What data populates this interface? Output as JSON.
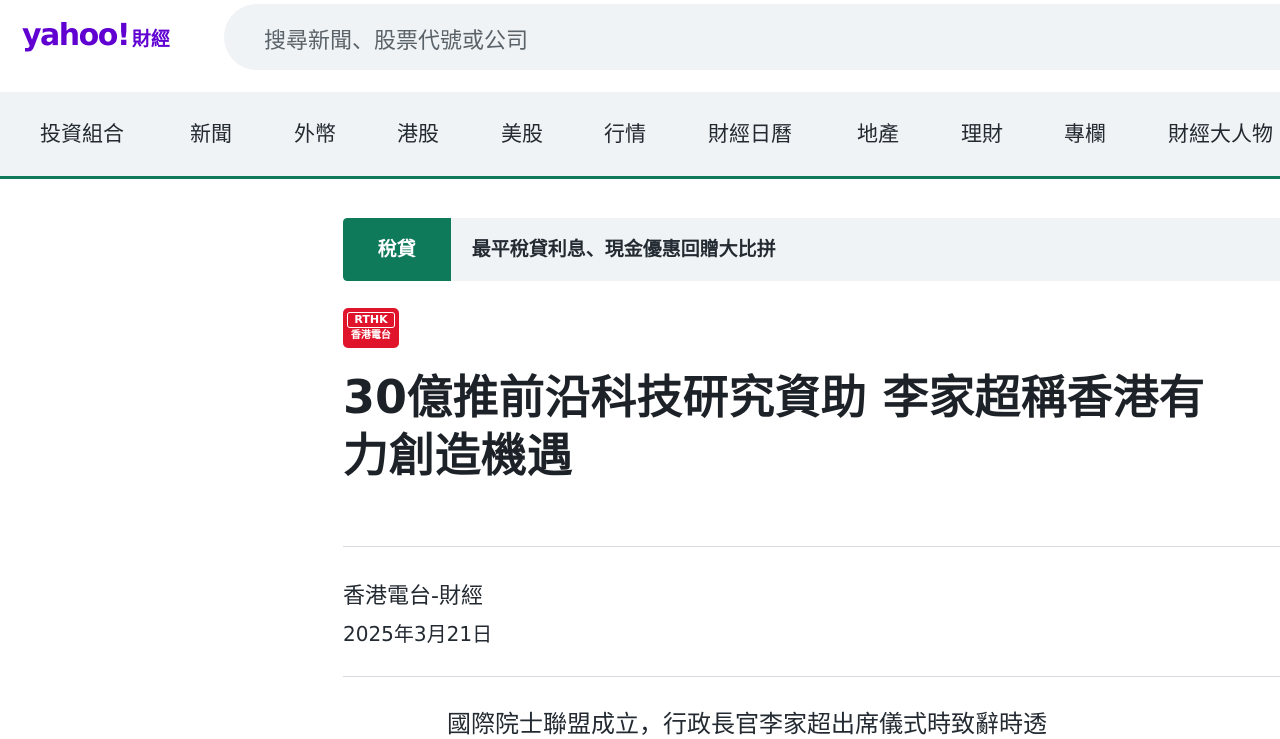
{
  "header": {
    "logo_word": "yahoo!",
    "logo_sub": "財經",
    "search_placeholder": "搜尋新聞、股票代號或公司"
  },
  "nav": {
    "items": [
      "投資組合",
      "新聞",
      "外幣",
      "港股",
      "美股",
      "行情",
      "財經日曆",
      "地產",
      "理財",
      "專欄",
      "財經大人物"
    ]
  },
  "promo": {
    "tag": "稅貸",
    "text": "最平稅貸利息、現金優惠回贈大比拼"
  },
  "article": {
    "source_logo_text": "RTHK",
    "source_logo_sub": "香港電台",
    "title_line1": "30億推前沿科技研究資助 李家超稱香港有",
    "title_line2": "力創造機遇",
    "byline": "香港電台-財經",
    "date": "2025年3月21日",
    "body_first_line": "國際院士聯盟成立，行政長官李家超出席儀式時致辭時透"
  },
  "colors": {
    "brand_purple": "#6001d2",
    "accent_green": "#0f7a5a",
    "nav_bg": "#f0f3f5",
    "rthk_red": "#e0142b"
  }
}
